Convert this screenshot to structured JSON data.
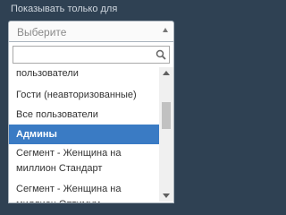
{
  "filter": {
    "label": "Показывать только для",
    "select": {
      "placeholder": "Выберите"
    },
    "search": {
      "value": "",
      "placeholder": ""
    },
    "options": [
      {
        "label": "пользователи",
        "highlighted": false
      },
      {
        "label": "Гости (неавторизованные)",
        "highlighted": false
      },
      {
        "label": "Все пользователи",
        "highlighted": false
      },
      {
        "label": "Админы",
        "highlighted": true
      },
      {
        "label": "Сегмент - Женщина на миллион Стандарт",
        "highlighted": false
      },
      {
        "label": "Сегмент - Женщина на миллион Оптимум",
        "highlighted": false
      }
    ],
    "scroll": {
      "thumb_position": 0.3
    }
  },
  "colors": {
    "background": "#2f4153",
    "highlight": "#3a7bc4"
  },
  "icons": {
    "search": "search-icon",
    "arrow": "chevron-up-icon"
  }
}
